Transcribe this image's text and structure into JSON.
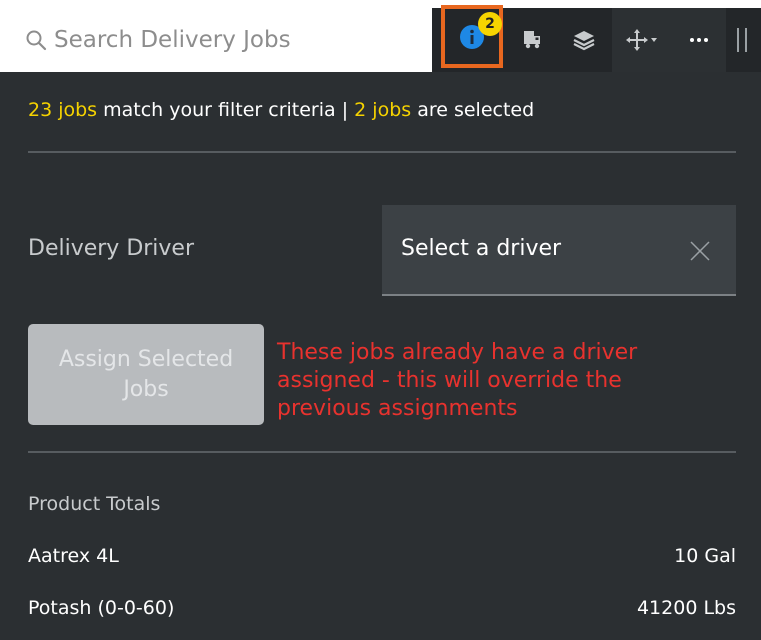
{
  "search": {
    "placeholder": "Search Delivery Jobs"
  },
  "toolbar": {
    "info_badge_count": "2",
    "icons": [
      "info-icon",
      "truck-icon",
      "layers-icon",
      "move-icon",
      "more-icon",
      "grip-icon"
    ],
    "highlight_color": "#e8671f",
    "badge_color": "#f7d400"
  },
  "status": {
    "jobs_count": "23 jobs",
    "match_text": " match your filter criteria | ",
    "selected_count": "2 jobs",
    "selected_text": " are selected"
  },
  "driver": {
    "label": "Delivery Driver",
    "select_value": "Select a driver"
  },
  "assign": {
    "button_label": "Assign Selected Jobs",
    "warning": "These jobs already have a driver assigned - this will override the previous assignments"
  },
  "totals": {
    "label": "Product Totals",
    "products": [
      {
        "name": "Aatrex 4L",
        "quantity": "10 Gal"
      },
      {
        "name": "Potash (0-0-60)",
        "quantity": "41200 Lbs"
      }
    ]
  },
  "colors": {
    "panel_bg": "#2b2f32",
    "accent_yellow": "#f5d200",
    "warning_red": "#e8322e"
  }
}
